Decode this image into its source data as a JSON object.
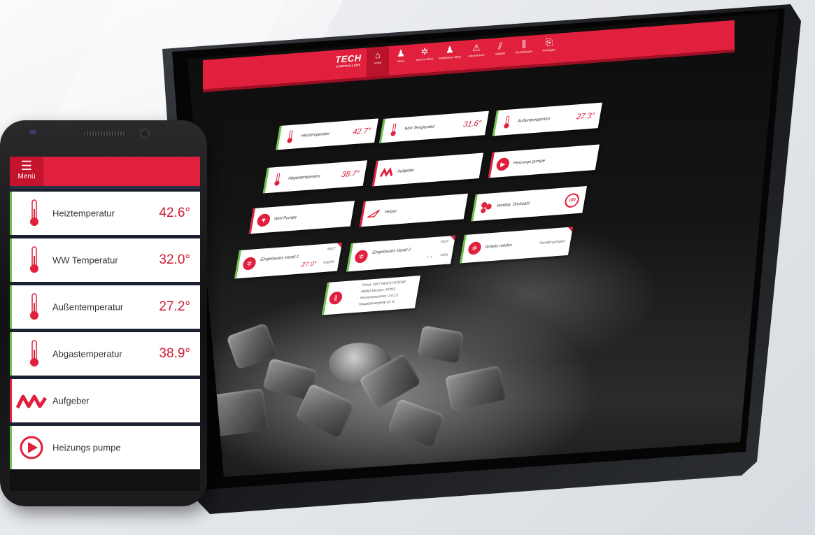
{
  "tablet": {
    "logo": {
      "brand": "TECH",
      "sub": "CONTROLLERS"
    },
    "nav": [
      {
        "label": "Home",
        "icon": "home-icon",
        "glyph": "⌂"
      },
      {
        "label": "Menü",
        "icon": "user-menu-icon",
        "glyph": "♟"
      },
      {
        "label": "Service-Menü",
        "icon": "service-icon",
        "glyph": "✲"
      },
      {
        "label": "Installateurs Menü",
        "icon": "installer-icon",
        "glyph": "♟"
      },
      {
        "label": "Alarmhistorie",
        "icon": "alarm-icon",
        "glyph": "⚠"
      },
      {
        "label": "Statistik",
        "icon": "statistics-icon",
        "glyph": "⫽"
      },
      {
        "label": "Einstellungen",
        "icon": "settings-icon",
        "glyph": "⫼"
      },
      {
        "label": "Ausloggen",
        "icon": "logout-icon",
        "glyph": "⎘"
      }
    ],
    "tiles": {
      "heiztemp": {
        "label": "Heiztemperatur",
        "value": "42.7°"
      },
      "ww_temp": {
        "label": "WW Temperatur",
        "value": "31.6°"
      },
      "aussen": {
        "label": "Außentemperatur",
        "value": "27.3°"
      },
      "abgas": {
        "label": "Abgastemperatur",
        "value": "38.7°"
      },
      "aufgeber": {
        "label": "Aufgeber"
      },
      "heizungspumpe": {
        "label": "Heizungs pumpe"
      },
      "ww_pumpe": {
        "label": "WW Pumpe"
      },
      "heizer": {
        "label": "Heizer"
      },
      "ventilat": {
        "label": "Ventilat. Drehzahl",
        "badge": "100"
      },
      "ventil1": {
        "label": "Eingebautes Ventil 1",
        "target": "56.0°",
        "value": "27.0°",
        "opening": "100%"
      },
      "ventil2": {
        "label": "Eingebautes Ventil 2",
        "target": "50.0°",
        "value": "- -",
        "opening": "0%"
      },
      "arbeitsmodus": {
        "label": "Arbeits modus",
        "mode": "Parallel pumpen"
      },
      "info": {
        "firma": "Firma: MAT HEIZSYSTEME",
        "modul": "Modul-Version: ST411",
        "version": "Versionsnummer: 2.6.13",
        "id": "Hauptsteuergerät ID: 8"
      }
    }
  },
  "phone": {
    "menu_label": "Menü",
    "rows": [
      {
        "label": "Heiztemperatur",
        "value": "42.6°",
        "icon": "thermometer-icon"
      },
      {
        "label": "WW Temperatur",
        "value": "32.0°",
        "icon": "thermometer-icon"
      },
      {
        "label": "Außentemperatur",
        "value": "27.2°",
        "icon": "thermometer-icon"
      },
      {
        "label": "Abgastemperatur",
        "value": "38.9°",
        "icon": "thermometer-icon"
      },
      {
        "label": "Aufgeber",
        "value": "",
        "icon": "feeder-icon"
      },
      {
        "label": "Heizungs pumpe",
        "value": "",
        "icon": "pump-icon"
      }
    ]
  },
  "colors": {
    "accent": "#e0203c",
    "ok": "#6cc24a",
    "dark": "#111111"
  }
}
